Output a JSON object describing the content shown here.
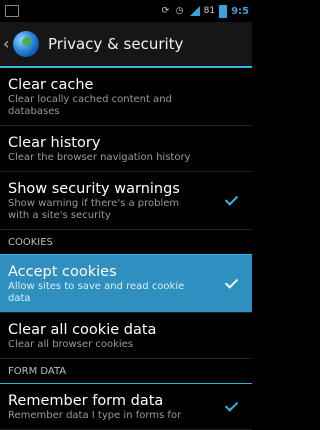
{
  "status_bar": {
    "time": "9:5",
    "signal_label": "81",
    "icons": [
      "notification-icon",
      "sync-icon",
      "alarm-icon",
      "signal-icon",
      "battery-icon"
    ]
  },
  "action_bar": {
    "title": "Privacy & security",
    "up_icon": "chevron-left-icon",
    "app_icon": "browser-globe-icon"
  },
  "items": [
    {
      "title": "Clear cache",
      "summary": "Clear locally cached content and databases",
      "checkbox": false
    },
    {
      "title": "Clear history",
      "summary": "Clear the browser navigation history",
      "checkbox": false
    },
    {
      "title": "Show security warnings",
      "summary": "Show warning if there's a problem with a site's security",
      "checkbox": true,
      "checked": true
    }
  ],
  "sections": {
    "cookies": "COOKIES",
    "form_data": "FORM DATA"
  },
  "cookie_items": [
    {
      "title": "Accept cookies",
      "summary": "Allow sites to save and read cookie data",
      "checkbox": true,
      "checked": true,
      "selected": true
    },
    {
      "title": "Clear all cookie data",
      "summary": "Clear all browser cookies",
      "checkbox": false
    }
  ],
  "form_items": [
    {
      "title": "Remember form data",
      "summary": "Remember data I type in forms for",
      "checkbox": true,
      "checked": true
    }
  ],
  "colors": {
    "accent": "#33b5e5",
    "selected_bg": "#2f8fbf"
  }
}
